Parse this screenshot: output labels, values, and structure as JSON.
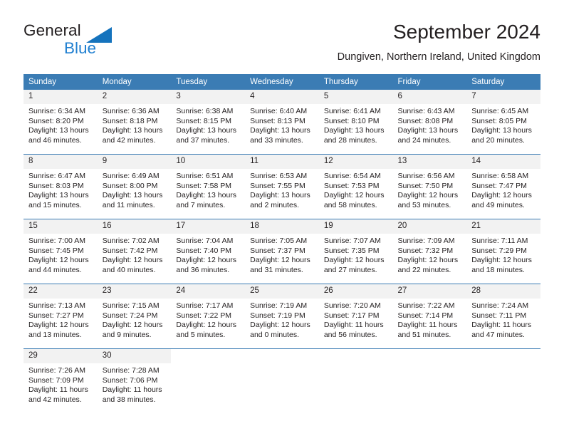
{
  "brand": {
    "name_top": "General",
    "name_bottom": "Blue",
    "triangle_color": "#1573bd",
    "blue_text_color": "#1f7fd0"
  },
  "header": {
    "title": "September 2024",
    "location": "Dungiven, Northern Ireland, United Kingdom"
  },
  "colors": {
    "header_blue": "#3b7cb4",
    "daynum_band": "#f2f2f2",
    "text": "#231f20"
  },
  "weekday_headers": [
    "Sunday",
    "Monday",
    "Tuesday",
    "Wednesday",
    "Thursday",
    "Friday",
    "Saturday"
  ],
  "weeks": [
    [
      {
        "day": "1",
        "sunrise": "Sunrise: 6:34 AM",
        "sunset": "Sunset: 8:20 PM",
        "daylight1": "Daylight: 13 hours",
        "daylight2": "and 46 minutes."
      },
      {
        "day": "2",
        "sunrise": "Sunrise: 6:36 AM",
        "sunset": "Sunset: 8:18 PM",
        "daylight1": "Daylight: 13 hours",
        "daylight2": "and 42 minutes."
      },
      {
        "day": "3",
        "sunrise": "Sunrise: 6:38 AM",
        "sunset": "Sunset: 8:15 PM",
        "daylight1": "Daylight: 13 hours",
        "daylight2": "and 37 minutes."
      },
      {
        "day": "4",
        "sunrise": "Sunrise: 6:40 AM",
        "sunset": "Sunset: 8:13 PM",
        "daylight1": "Daylight: 13 hours",
        "daylight2": "and 33 minutes."
      },
      {
        "day": "5",
        "sunrise": "Sunrise: 6:41 AM",
        "sunset": "Sunset: 8:10 PM",
        "daylight1": "Daylight: 13 hours",
        "daylight2": "and 28 minutes."
      },
      {
        "day": "6",
        "sunrise": "Sunrise: 6:43 AM",
        "sunset": "Sunset: 8:08 PM",
        "daylight1": "Daylight: 13 hours",
        "daylight2": "and 24 minutes."
      },
      {
        "day": "7",
        "sunrise": "Sunrise: 6:45 AM",
        "sunset": "Sunset: 8:05 PM",
        "daylight1": "Daylight: 13 hours",
        "daylight2": "and 20 minutes."
      }
    ],
    [
      {
        "day": "8",
        "sunrise": "Sunrise: 6:47 AM",
        "sunset": "Sunset: 8:03 PM",
        "daylight1": "Daylight: 13 hours",
        "daylight2": "and 15 minutes."
      },
      {
        "day": "9",
        "sunrise": "Sunrise: 6:49 AM",
        "sunset": "Sunset: 8:00 PM",
        "daylight1": "Daylight: 13 hours",
        "daylight2": "and 11 minutes."
      },
      {
        "day": "10",
        "sunrise": "Sunrise: 6:51 AM",
        "sunset": "Sunset: 7:58 PM",
        "daylight1": "Daylight: 13 hours",
        "daylight2": "and 7 minutes."
      },
      {
        "day": "11",
        "sunrise": "Sunrise: 6:53 AM",
        "sunset": "Sunset: 7:55 PM",
        "daylight1": "Daylight: 13 hours",
        "daylight2": "and 2 minutes."
      },
      {
        "day": "12",
        "sunrise": "Sunrise: 6:54 AM",
        "sunset": "Sunset: 7:53 PM",
        "daylight1": "Daylight: 12 hours",
        "daylight2": "and 58 minutes."
      },
      {
        "day": "13",
        "sunrise": "Sunrise: 6:56 AM",
        "sunset": "Sunset: 7:50 PM",
        "daylight1": "Daylight: 12 hours",
        "daylight2": "and 53 minutes."
      },
      {
        "day": "14",
        "sunrise": "Sunrise: 6:58 AM",
        "sunset": "Sunset: 7:47 PM",
        "daylight1": "Daylight: 12 hours",
        "daylight2": "and 49 minutes."
      }
    ],
    [
      {
        "day": "15",
        "sunrise": "Sunrise: 7:00 AM",
        "sunset": "Sunset: 7:45 PM",
        "daylight1": "Daylight: 12 hours",
        "daylight2": "and 44 minutes."
      },
      {
        "day": "16",
        "sunrise": "Sunrise: 7:02 AM",
        "sunset": "Sunset: 7:42 PM",
        "daylight1": "Daylight: 12 hours",
        "daylight2": "and 40 minutes."
      },
      {
        "day": "17",
        "sunrise": "Sunrise: 7:04 AM",
        "sunset": "Sunset: 7:40 PM",
        "daylight1": "Daylight: 12 hours",
        "daylight2": "and 36 minutes."
      },
      {
        "day": "18",
        "sunrise": "Sunrise: 7:05 AM",
        "sunset": "Sunset: 7:37 PM",
        "daylight1": "Daylight: 12 hours",
        "daylight2": "and 31 minutes."
      },
      {
        "day": "19",
        "sunrise": "Sunrise: 7:07 AM",
        "sunset": "Sunset: 7:35 PM",
        "daylight1": "Daylight: 12 hours",
        "daylight2": "and 27 minutes."
      },
      {
        "day": "20",
        "sunrise": "Sunrise: 7:09 AM",
        "sunset": "Sunset: 7:32 PM",
        "daylight1": "Daylight: 12 hours",
        "daylight2": "and 22 minutes."
      },
      {
        "day": "21",
        "sunrise": "Sunrise: 7:11 AM",
        "sunset": "Sunset: 7:29 PM",
        "daylight1": "Daylight: 12 hours",
        "daylight2": "and 18 minutes."
      }
    ],
    [
      {
        "day": "22",
        "sunrise": "Sunrise: 7:13 AM",
        "sunset": "Sunset: 7:27 PM",
        "daylight1": "Daylight: 12 hours",
        "daylight2": "and 13 minutes."
      },
      {
        "day": "23",
        "sunrise": "Sunrise: 7:15 AM",
        "sunset": "Sunset: 7:24 PM",
        "daylight1": "Daylight: 12 hours",
        "daylight2": "and 9 minutes."
      },
      {
        "day": "24",
        "sunrise": "Sunrise: 7:17 AM",
        "sunset": "Sunset: 7:22 PM",
        "daylight1": "Daylight: 12 hours",
        "daylight2": "and 5 minutes."
      },
      {
        "day": "25",
        "sunrise": "Sunrise: 7:19 AM",
        "sunset": "Sunset: 7:19 PM",
        "daylight1": "Daylight: 12 hours",
        "daylight2": "and 0 minutes."
      },
      {
        "day": "26",
        "sunrise": "Sunrise: 7:20 AM",
        "sunset": "Sunset: 7:17 PM",
        "daylight1": "Daylight: 11 hours",
        "daylight2": "and 56 minutes."
      },
      {
        "day": "27",
        "sunrise": "Sunrise: 7:22 AM",
        "sunset": "Sunset: 7:14 PM",
        "daylight1": "Daylight: 11 hours",
        "daylight2": "and 51 minutes."
      },
      {
        "day": "28",
        "sunrise": "Sunrise: 7:24 AM",
        "sunset": "Sunset: 7:11 PM",
        "daylight1": "Daylight: 11 hours",
        "daylight2": "and 47 minutes."
      }
    ],
    [
      {
        "day": "29",
        "sunrise": "Sunrise: 7:26 AM",
        "sunset": "Sunset: 7:09 PM",
        "daylight1": "Daylight: 11 hours",
        "daylight2": "and 42 minutes."
      },
      {
        "day": "30",
        "sunrise": "Sunrise: 7:28 AM",
        "sunset": "Sunset: 7:06 PM",
        "daylight1": "Daylight: 11 hours",
        "daylight2": "and 38 minutes."
      },
      {
        "day": "",
        "sunrise": "",
        "sunset": "",
        "daylight1": "",
        "daylight2": ""
      },
      {
        "day": "",
        "sunrise": "",
        "sunset": "",
        "daylight1": "",
        "daylight2": ""
      },
      {
        "day": "",
        "sunrise": "",
        "sunset": "",
        "daylight1": "",
        "daylight2": ""
      },
      {
        "day": "",
        "sunrise": "",
        "sunset": "",
        "daylight1": "",
        "daylight2": ""
      },
      {
        "day": "",
        "sunrise": "",
        "sunset": "",
        "daylight1": "",
        "daylight2": ""
      }
    ]
  ]
}
